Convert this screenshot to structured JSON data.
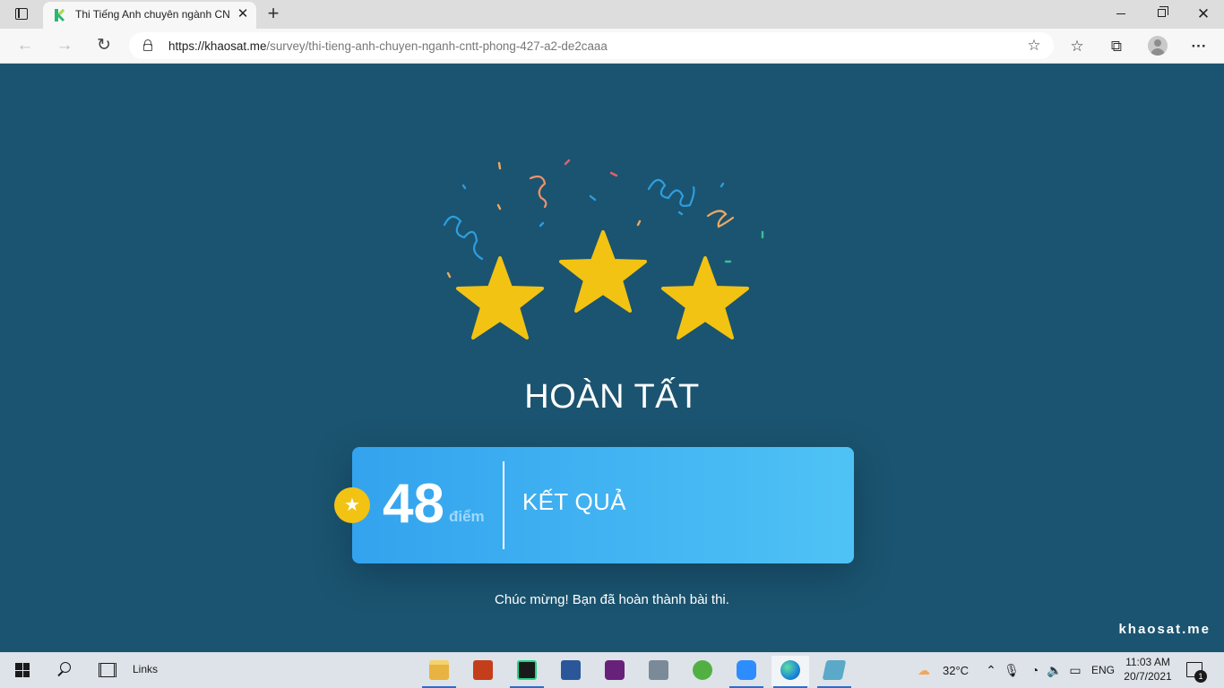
{
  "browser": {
    "tab_title": "Thi Tiếng Anh chuyên ngành CNTT",
    "tab_close": "✕",
    "new_tab": "+",
    "url_host": "https://khaosat.me",
    "url_path": "/survey/thi-tieng-anh-chuyen-nganh-cntt-phong-427-a2-de2caaa",
    "back": "←",
    "forward": "→",
    "refresh": "↻",
    "favorites_add": "☆",
    "favorites": "☆",
    "collections": "⧉",
    "more": "···",
    "window_close": "✕",
    "colors": {
      "titlebar": "#dddddd",
      "toolbar": "#f7f7f7"
    }
  },
  "page": {
    "background": "#1b5470",
    "stars": {
      "count": 3,
      "color": "#f2c313"
    },
    "heading": "HOÀN TẤT",
    "score": {
      "value": "48",
      "unit": "điểm",
      "badge_icon": "★",
      "result_label": "KẾT QUẢ"
    },
    "message": "Chúc mừng! Bạn đã hoàn thành bài thi.",
    "watermark": "khaosat.me"
  },
  "taskbar": {
    "links_label": "Links",
    "pinned_apps": [
      {
        "name": "file-explorer",
        "color": "#e8b341"
      },
      {
        "name": "powerpoint",
        "color": "#c43e1c"
      },
      {
        "name": "pycharm",
        "color": "#1a1a1a"
      },
      {
        "name": "word",
        "color": "#2b579a"
      },
      {
        "name": "visual-studio",
        "color": "#68217a"
      },
      {
        "name": "settings-tool",
        "color": "#7a8a99"
      },
      {
        "name": "coccoc",
        "color": "#52b043"
      },
      {
        "name": "zoom",
        "color": "#2d8cff"
      },
      {
        "name": "edge",
        "color": "#1e88d6"
      },
      {
        "name": "notes",
        "color": "#5aa9c9"
      }
    ],
    "weather": "32°C",
    "language": "ENG",
    "time": "11:03 AM",
    "date": "20/7/2021",
    "notification_count": "1"
  }
}
